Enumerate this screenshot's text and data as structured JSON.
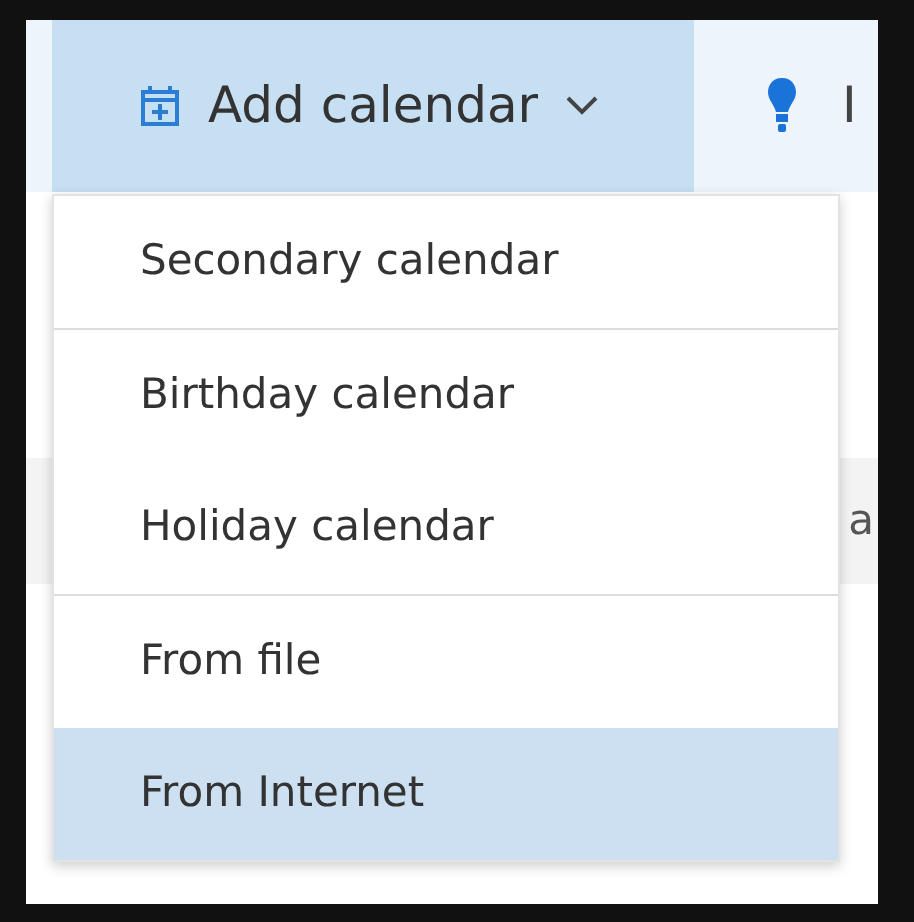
{
  "toolbar": {
    "add_button": {
      "label": "Add calendar",
      "expanded": true
    },
    "next_button": {
      "label": "I"
    }
  },
  "menu": {
    "items": [
      {
        "label": "Secondary calendar",
        "selected": false,
        "divider_after": true
      },
      {
        "label": "Birthday calendar",
        "selected": false,
        "divider_after": false
      },
      {
        "label": "Holiday calendar",
        "selected": false,
        "divider_after": true
      },
      {
        "label": "From file",
        "selected": false,
        "divider_after": false
      },
      {
        "label": "From Internet",
        "selected": true,
        "divider_after": false
      }
    ]
  },
  "background": {
    "row_text": "a"
  }
}
